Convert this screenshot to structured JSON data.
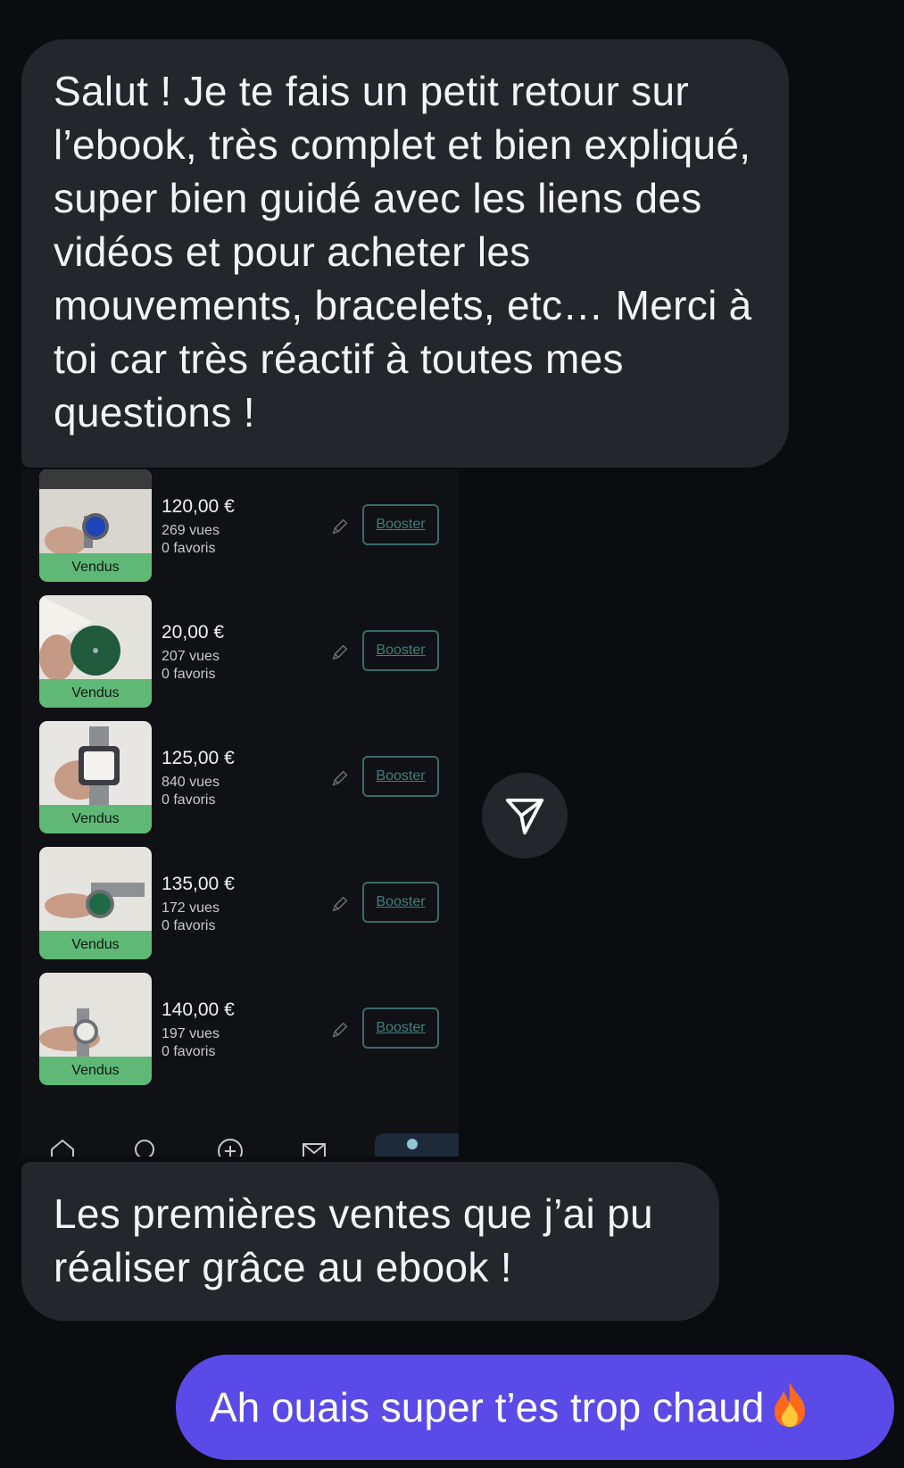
{
  "messages": {
    "received_1": "Salut ! Je te fais un petit retour sur l’ebook, très complet et bien expliqué, super bien guidé avec les liens des vidéos et pour acheter les mouvements, bracelets, etc… Merci à toi car très réactif à toutes mes questions !",
    "received_2": "Les premières ventes que j’ai pu réaliser grâce au ebook !",
    "sent_1": "Ah ouais super t’es trop chaud"
  },
  "listings": [
    {
      "price": "120,00 €",
      "views": "269 vues",
      "favorites": "0 favoris",
      "status": "Vendus",
      "boost": "Booster"
    },
    {
      "price": "20,00 €",
      "views": "207 vues",
      "favorites": "0 favoris",
      "status": "Vendus",
      "boost": "Booster"
    },
    {
      "price": "125,00 €",
      "views": "840 vues",
      "favorites": "0 favoris",
      "status": "Vendus",
      "boost": "Booster"
    },
    {
      "price": "135,00 €",
      "views": "172 vues",
      "favorites": "0 favoris",
      "status": "Vendus",
      "boost": "Booster"
    },
    {
      "price": "140,00 €",
      "views": "197 vues",
      "favorites": "0 favoris",
      "status": "Vendus",
      "boost": "Booster"
    }
  ],
  "icons": [
    "home-icon",
    "search-icon",
    "add-icon",
    "mail-icon",
    "profile-icon",
    "pencil-icon",
    "send-icon",
    "fire-emoji"
  ],
  "colors": {
    "background": "#0b0c0f",
    "bubble_in": "#25262b",
    "bubble_out": "#5a4be8",
    "sold_badge": "#5fb876",
    "booster": "#3f7f7f"
  }
}
